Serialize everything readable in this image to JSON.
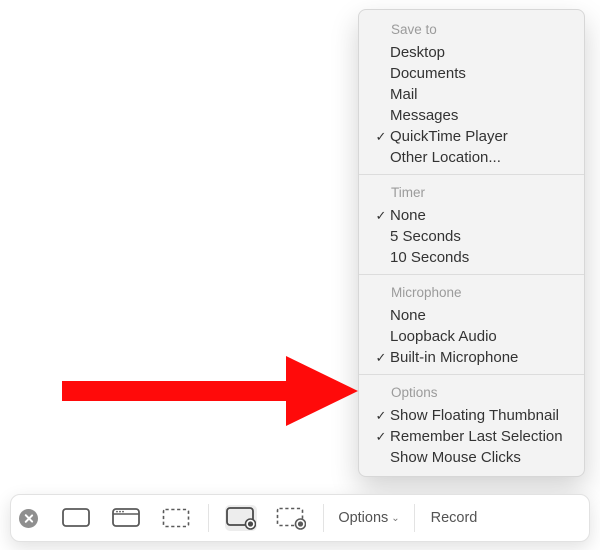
{
  "menu": {
    "sections": [
      {
        "header": "Save to",
        "items": [
          {
            "label": "Desktop",
            "checked": false
          },
          {
            "label": "Documents",
            "checked": false
          },
          {
            "label": "Mail",
            "checked": false
          },
          {
            "label": "Messages",
            "checked": false
          },
          {
            "label": "QuickTime Player",
            "checked": true
          },
          {
            "label": "Other Location...",
            "checked": false
          }
        ]
      },
      {
        "header": "Timer",
        "items": [
          {
            "label": "None",
            "checked": true
          },
          {
            "label": "5 Seconds",
            "checked": false
          },
          {
            "label": "10 Seconds",
            "checked": false
          }
        ]
      },
      {
        "header": "Microphone",
        "items": [
          {
            "label": "None",
            "checked": false
          },
          {
            "label": "Loopback Audio",
            "checked": false
          },
          {
            "label": "Built-in Microphone",
            "checked": true
          }
        ]
      },
      {
        "header": "Options",
        "items": [
          {
            "label": "Show Floating Thumbnail",
            "checked": true
          },
          {
            "label": "Remember Last Selection",
            "checked": true
          },
          {
            "label": "Show Mouse Clicks",
            "checked": false
          }
        ]
      }
    ]
  },
  "toolbar": {
    "options_label": "Options",
    "record_label": "Record"
  },
  "arrow": {
    "color": "#ff0a0a"
  }
}
